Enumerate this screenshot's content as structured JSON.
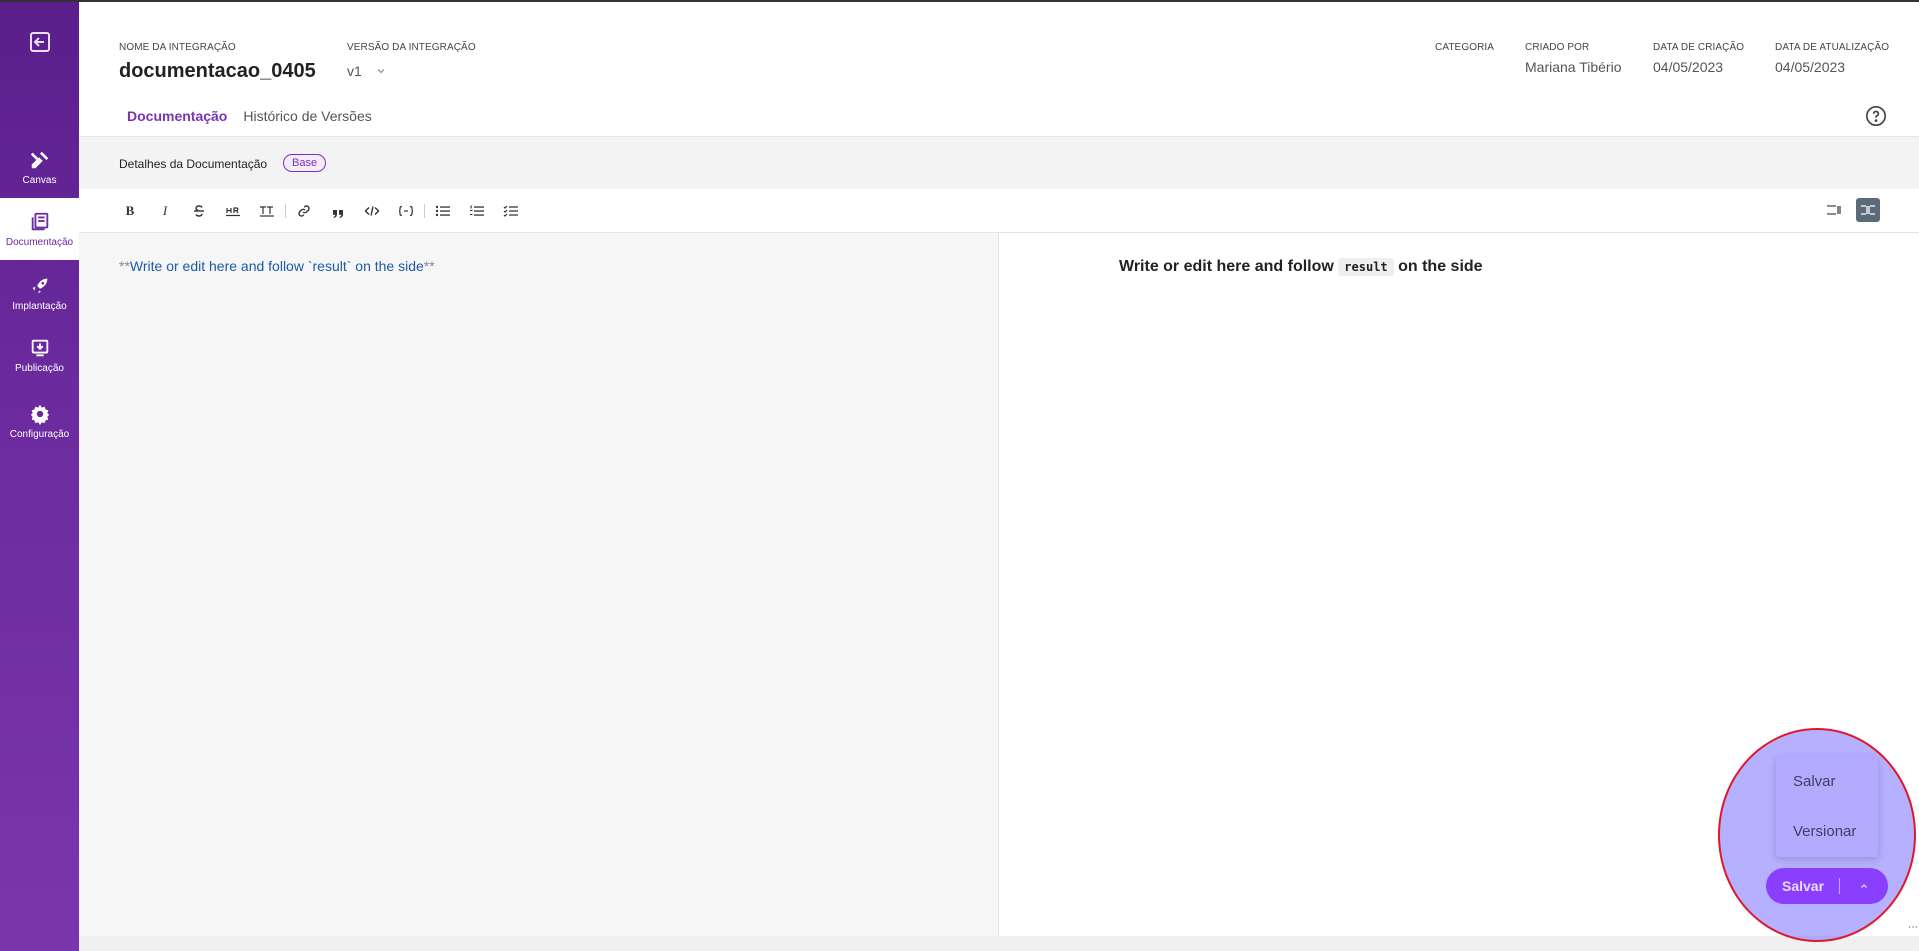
{
  "sidebar": {
    "items": [
      {
        "label": "Canvas",
        "icon": "tools-icon"
      },
      {
        "label": "Documentação",
        "icon": "book-icon"
      },
      {
        "label": "Implantação",
        "icon": "rocket-icon"
      },
      {
        "label": "Publicação",
        "icon": "download-screen-icon"
      },
      {
        "label": "Configuração",
        "icon": "gear-icon"
      }
    ]
  },
  "header": {
    "name_label": "NOME DA INTEGRAÇÃO",
    "name_value": "documentacao_0405",
    "version_label": "VERSÃO DA INTEGRAÇÃO",
    "version_value": "v1",
    "category_label": "CATEGORIA",
    "created_by_label": "CRIADO POR",
    "created_by_value": "Mariana Tibério",
    "created_at_label": "DATA DE CRIAÇÃO",
    "created_at_value": "04/05/2023",
    "updated_at_label": "DATA DE ATUALIZAÇÃO",
    "updated_at_value": "04/05/2023"
  },
  "tabs": [
    {
      "label": "Documentação",
      "active": true
    },
    {
      "label": "Histórico de Versões",
      "active": false
    }
  ],
  "subbar": {
    "text": "Detalhes da Documentação",
    "badge": "Base"
  },
  "toolbar": {
    "buttons": [
      "B",
      "I",
      "strike",
      "HR",
      "title",
      "link",
      "quote",
      "code",
      "code-block",
      "unordered-list",
      "ordered-list",
      "check-list"
    ]
  },
  "editor": {
    "prefix": "**",
    "text": "Write or edit here and follow `result` on the side",
    "suffix": "**"
  },
  "preview": {
    "text_before": "Write or edit here and follow",
    "code": "result",
    "text_after": "on the side"
  },
  "save_menu": {
    "items": [
      "Salvar",
      "Versionar"
    ],
    "button_label": "Salvar"
  },
  "colors": {
    "accent": "#7a32b8",
    "sidebar": "#6b2a9e",
    "highlight_ring": "#e0192a"
  }
}
